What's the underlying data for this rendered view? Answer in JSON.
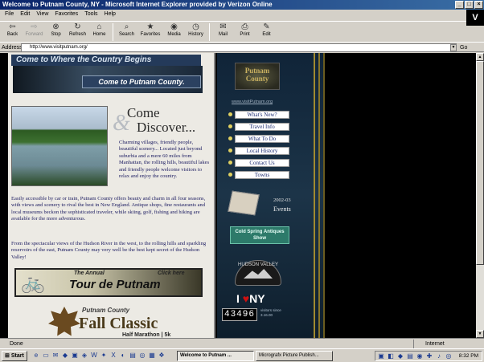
{
  "window": {
    "title": "Welcome to Putnam County, NY - Microsoft Internet Explorer provided by Verizon Online"
  },
  "menubar": [
    "File",
    "Edit",
    "View",
    "Favorites",
    "Tools",
    "Help"
  ],
  "brand_logo": "V",
  "toolbar": [
    {
      "label": "Back",
      "icon": "back-arrow-icon"
    },
    {
      "label": "Forward",
      "icon": "forward-arrow-icon"
    },
    {
      "label": "Stop",
      "icon": "stop-icon"
    },
    {
      "label": "Refresh",
      "icon": "refresh-icon"
    },
    {
      "label": "Home",
      "icon": "home-icon"
    },
    {
      "label": "Search",
      "icon": "search-icon"
    },
    {
      "label": "Favorites",
      "icon": "favorites-icon"
    },
    {
      "label": "Media",
      "icon": "media-icon"
    },
    {
      "label": "History",
      "icon": "history-icon"
    },
    {
      "label": "Mail",
      "icon": "mail-icon"
    },
    {
      "label": "Print",
      "icon": "print-icon"
    },
    {
      "label": "Edit",
      "icon": "edit-icon"
    }
  ],
  "address": {
    "label": "Address",
    "value": "http://www.visitputnam.org/",
    "go": "Go"
  },
  "page": {
    "banner_top": "Come to Where the Country Begins",
    "banner_sub": "Come to Putnam County.",
    "come": "Come",
    "discover": "Discover...",
    "intro": "Charming villages, friendly people, beautiful scenery... Located just beyond suburbia and a mere 60 miles from Manhattan, the rolling hills, beautiful lakes and friendly people welcome visitors to relax and enjoy the country.",
    "para2": "Easily accessible by car or train, Putnam County offers beauty and charm in all four seasons, with views and scenery to rival the best in New England. Antique shops, fine restaurants and local museums beckon the sophisticated traveler, while skiing, golf, fishing and hiking are available for the more adventurous.",
    "para3": "From the spectacular views of the Hudson River in the west, to the rolling hills and sparkling reservoirs of the east, Putnam County may very well be the best kept secret of the Hudson Valley!",
    "tour_annual": "The Annual",
    "tour_name": "Tour de Putnam",
    "tour_click": "Click here",
    "fall_county": "Putnam County",
    "fall_classic": "Fall Classic",
    "fall_race": "Half Marathon | 5k"
  },
  "nav": {
    "logo": "Putnam County",
    "url": "www.visitPutnam.org",
    "items": [
      "What's New?",
      "Travel Info",
      "What To Do",
      "Local History",
      "Contact Us",
      "Towns"
    ],
    "events_year": "2002-03",
    "events_label": "Events",
    "antiques": "Cold Spring Antiques Show",
    "hv_logo": "HUDSON VALLEY",
    "iloveny_i": "I",
    "iloveny_heart": "♥",
    "iloveny_ny": "NY",
    "counter": "43496",
    "counter_note": "visitors since 3.16.00"
  },
  "status": {
    "text": "Done",
    "zone": "Internet"
  },
  "taskbar": {
    "start": "Start",
    "tasks": [
      "Welcome to Putnam ...",
      "Micrografx Picture Publish..."
    ],
    "clock": "8:32 PM"
  }
}
